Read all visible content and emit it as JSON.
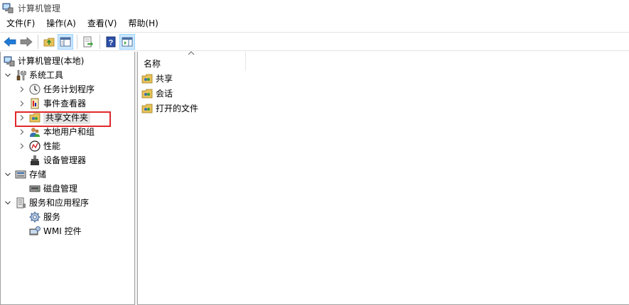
{
  "window": {
    "title": "计算机管理"
  },
  "menu": [
    "文件(F)",
    "操作(A)",
    "查看(V)",
    "帮助(H)"
  ],
  "toolbar": {
    "buttons": [
      "back-icon",
      "forward-icon",
      "up-folder-icon",
      "show-hide-tree-icon",
      "export-list-icon",
      "help-icon",
      "action-pane-icon"
    ]
  },
  "tree": [
    {
      "label": "计算机管理(本地)",
      "icon": "computer-management-icon",
      "level": 0,
      "expand": ""
    },
    {
      "label": "系统工具",
      "icon": "system-tools-icon",
      "level": 1,
      "expand": "expanded"
    },
    {
      "label": "任务计划程序",
      "icon": "clock-icon",
      "level": 2,
      "expand": "collapsed"
    },
    {
      "label": "事件查看器",
      "icon": "event-viewer-icon",
      "level": 2,
      "expand": "collapsed"
    },
    {
      "label": "共享文件夹",
      "icon": "shared-folder-icon",
      "level": 2,
      "expand": "collapsed",
      "selected": true
    },
    {
      "label": "本地用户和组",
      "icon": "users-icon",
      "level": 2,
      "expand": "collapsed"
    },
    {
      "label": "性能",
      "icon": "performance-icon",
      "level": 2,
      "expand": "collapsed"
    },
    {
      "label": "设备管理器",
      "icon": "device-manager-icon",
      "level": 2,
      "expand": ""
    },
    {
      "label": "存储",
      "icon": "storage-icon",
      "level": 1,
      "expand": "expanded"
    },
    {
      "label": "磁盘管理",
      "icon": "disk-icon",
      "level": 2,
      "expand": ""
    },
    {
      "label": "服务和应用程序",
      "icon": "services-apps-icon",
      "level": 1,
      "expand": "expanded"
    },
    {
      "label": "服务",
      "icon": "gear-icon",
      "level": 2,
      "expand": ""
    },
    {
      "label": "WMI 控件",
      "icon": "wmi-icon",
      "level": 2,
      "expand": ""
    }
  ],
  "list": {
    "column": "名称",
    "sort": "ascending",
    "items": [
      "共享",
      "会话",
      "打开的文件"
    ]
  },
  "colors": {
    "highlight": "#e0282b",
    "selection": "#e5e5e5",
    "toolbar_active": "#cce8ff"
  }
}
